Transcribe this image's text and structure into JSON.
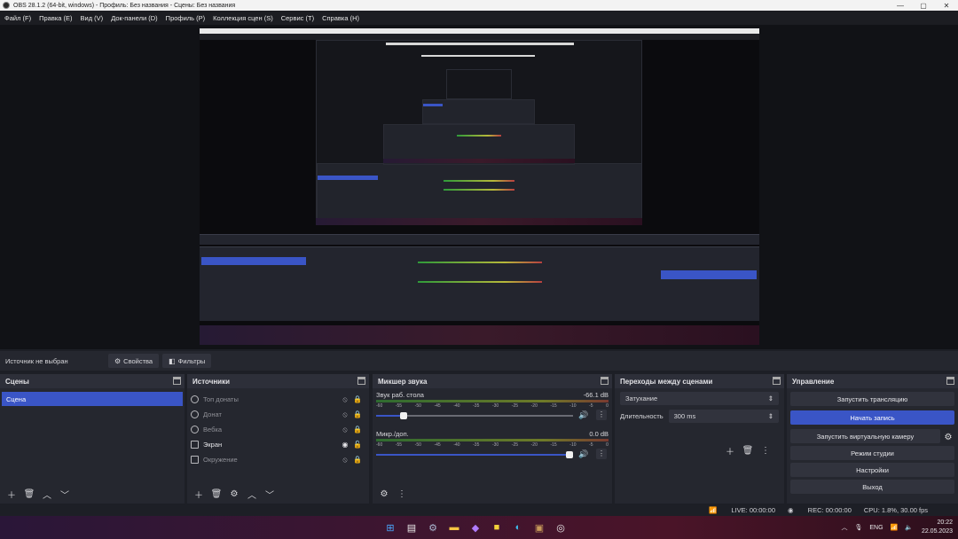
{
  "window": {
    "title": "OBS 28.1.2 (64-bit, windows) - Профиль: Без названия - Сцены: Без названия",
    "controls": [
      "—",
      "▢",
      "✕"
    ]
  },
  "menu": [
    "Файл (F)",
    "Правка (E)",
    "Вид (V)",
    "Док-панели (D)",
    "Профиль (P)",
    "Коллекция сцен (S)",
    "Сервис (T)",
    "Справка (H)"
  ],
  "context": {
    "label": "Источник не выбран",
    "properties": "Свойства",
    "filters": "Фильтры"
  },
  "scenes": {
    "title": "Сцены",
    "items": [
      "Сцена"
    ]
  },
  "sources": {
    "title": "Источники",
    "items": [
      {
        "name": "Топ донаты",
        "icon": "globe-icon",
        "visible": false
      },
      {
        "name": "Донат",
        "icon": "globe-icon",
        "visible": false
      },
      {
        "name": "Вебка",
        "icon": "globe-icon",
        "visible": false
      },
      {
        "name": "Экран",
        "icon": "monitor-icon",
        "visible": true
      },
      {
        "name": "Окружение",
        "icon": "image-icon",
        "visible": false
      }
    ]
  },
  "mixer": {
    "title": "Микшер звука",
    "ticks": [
      "-60",
      "-55",
      "-50",
      "-45",
      "-40",
      "-35",
      "-30",
      "-25",
      "-20",
      "-15",
      "-10",
      "-5",
      "0"
    ],
    "channels": [
      {
        "name": "Звук раб. стола",
        "level": "-66.1 dB",
        "volume_fraction": 0.14
      },
      {
        "name": "Микр./доп.",
        "level": "0.0 dB",
        "volume_fraction": 1.0
      }
    ]
  },
  "transitions": {
    "title": "Переходы между сценами",
    "selected": "Затухание",
    "duration_label": "Длительность",
    "duration_value": "300 ms"
  },
  "controls": {
    "title": "Управление",
    "start_stream": "Запустить трансляцию",
    "start_record": "Начать запись",
    "virtual_cam": "Запустить виртуальную камеру",
    "studio_mode": "Режим студии",
    "settings": "Настройки",
    "exit": "Выход"
  },
  "status": {
    "live": "LIVE: 00:00:00",
    "rec": "REC: 00:00:00",
    "cpu": "CPU: 1.8%, 30.00 fps"
  },
  "taskbar": {
    "lang": "ENG",
    "time": "20:22",
    "date": "22.05.2023",
    "icons": [
      "windows-start-icon",
      "file-explorer-icon",
      "settings-icon",
      "folder-icon",
      "app-icon",
      "sticky-notes-icon",
      "edge-icon",
      "package-icon",
      "obs-icon"
    ]
  },
  "colors": {
    "accent": "#3a55c6",
    "dock_bg": "#25272f",
    "header_bg": "#2d2f39"
  }
}
